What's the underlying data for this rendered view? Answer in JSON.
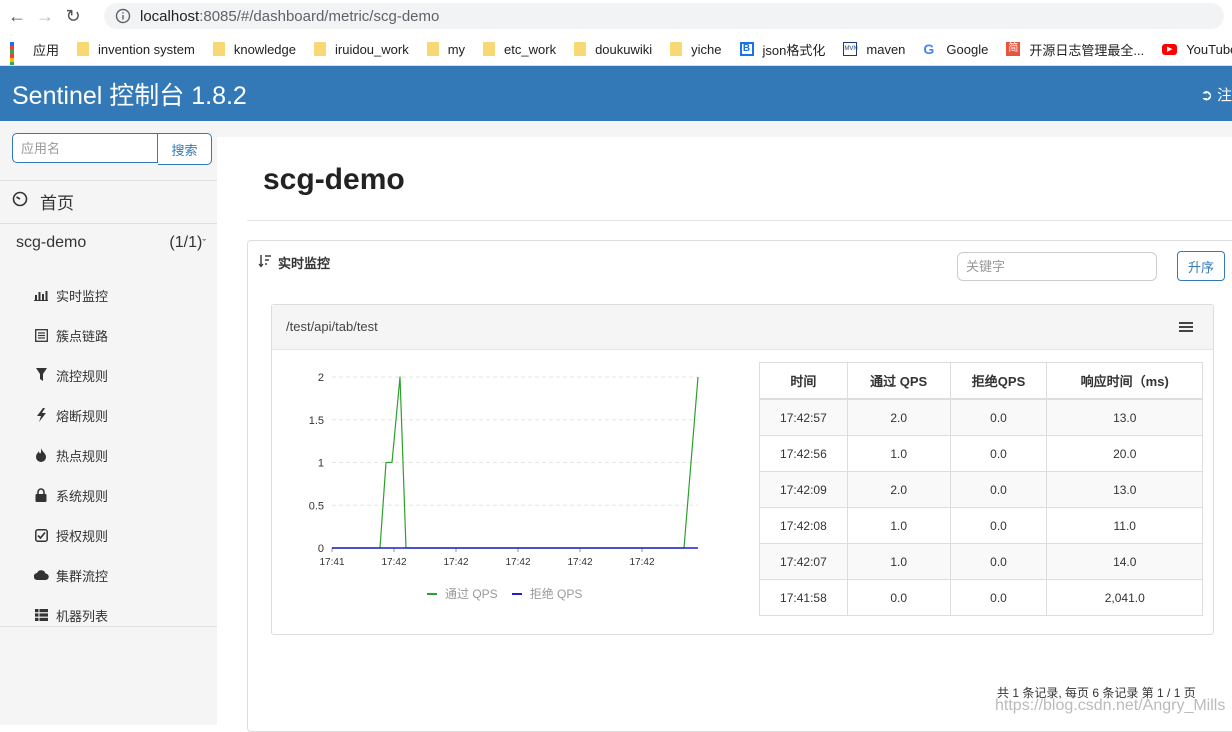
{
  "browser": {
    "url_host": "localhost",
    "url_rest": ":8085/#/dashboard/metric/scg-demo",
    "bookmarks": [
      {
        "label": "应用",
        "icon": "apps-grid-icon"
      },
      {
        "label": "invention system",
        "icon": "folder-icon"
      },
      {
        "label": "knowledge",
        "icon": "folder-icon"
      },
      {
        "label": "iruidou_work",
        "icon": "folder-icon"
      },
      {
        "label": "my",
        "icon": "folder-icon"
      },
      {
        "label": "etc_work",
        "icon": "folder-icon"
      },
      {
        "label": "doukuwiki",
        "icon": "folder-icon"
      },
      {
        "label": "yiche",
        "icon": "folder-icon"
      },
      {
        "label": "json格式化",
        "icon": "bejson-icon"
      },
      {
        "label": "maven",
        "icon": "maven-icon"
      },
      {
        "label": "Google",
        "icon": "google-icon"
      },
      {
        "label": "开源日志管理最全...",
        "icon": "jian-icon"
      },
      {
        "label": "YouTube",
        "icon": "youtube-icon"
      }
    ]
  },
  "header": {
    "title": "Sentinel 控制台 1.8.2",
    "logout_label": "注"
  },
  "sidebar": {
    "search_placeholder": "应用名",
    "search_button": "搜索",
    "home_label": "首页",
    "app_name": "scg-demo",
    "app_count": "(1/1)",
    "menu": [
      {
        "label": "实时监控",
        "icon": "bar-chart-icon"
      },
      {
        "label": "簇点链路",
        "icon": "list-icon"
      },
      {
        "label": "流控规则",
        "icon": "filter-icon"
      },
      {
        "label": "熔断规则",
        "icon": "flash-icon"
      },
      {
        "label": "热点规则",
        "icon": "fire-icon"
      },
      {
        "label": "系统规则",
        "icon": "lock-icon"
      },
      {
        "label": "授权规则",
        "icon": "check-square-icon"
      },
      {
        "label": "集群流控",
        "icon": "cloud-icon"
      },
      {
        "label": "机器列表",
        "icon": "th-list-icon"
      }
    ]
  },
  "main": {
    "page_title": "scg-demo",
    "panel_title": "实时监控",
    "keyword_placeholder": "关键字",
    "sort_button": "升序",
    "card_title": "/test/api/tab/test",
    "table": {
      "headers": [
        "时间",
        "通过 QPS",
        "拒绝QPS",
        "响应时间（ms)"
      ],
      "rows": [
        [
          "17:42:57",
          "2.0",
          "0.0",
          "13.0"
        ],
        [
          "17:42:56",
          "1.0",
          "0.0",
          "20.0"
        ],
        [
          "17:42:09",
          "2.0",
          "0.0",
          "13.0"
        ],
        [
          "17:42:08",
          "1.0",
          "0.0",
          "11.0"
        ],
        [
          "17:42:07",
          "1.0",
          "0.0",
          "14.0"
        ],
        [
          "17:41:58",
          "0.0",
          "0.0",
          "2,041.0"
        ]
      ]
    },
    "pager": "共 1 条记录, 每页 6 条记录 第 1 / 1 页"
  },
  "watermark": "https://blog.csdn.net/Angry_Mills",
  "colors": {
    "header_bg": "#3379b7",
    "pass_qps": "#2ca02c",
    "block_qps": "#1f1fcf"
  },
  "chart_data": {
    "type": "line",
    "x_tick_labels": [
      "17:41",
      "17:42",
      "17:42",
      "17:42",
      "17:42",
      "17:42"
    ],
    "y_ticks": [
      0,
      0.5,
      1,
      1.5,
      2
    ],
    "ylim": [
      0,
      2
    ],
    "series": [
      {
        "name": "通过 QPS",
        "color": "#2ca02c",
        "points": [
          [
            0,
            0
          ],
          [
            48,
            0
          ],
          [
            54,
            1
          ],
          [
            60,
            1
          ],
          [
            68,
            2
          ],
          [
            74,
            0
          ],
          [
            352,
            0
          ],
          [
            366,
            2
          ]
        ]
      },
      {
        "name": "拒绝 QPS",
        "color": "#1f1fcf",
        "points": [
          [
            0,
            0
          ],
          [
            366,
            0
          ]
        ]
      }
    ]
  }
}
